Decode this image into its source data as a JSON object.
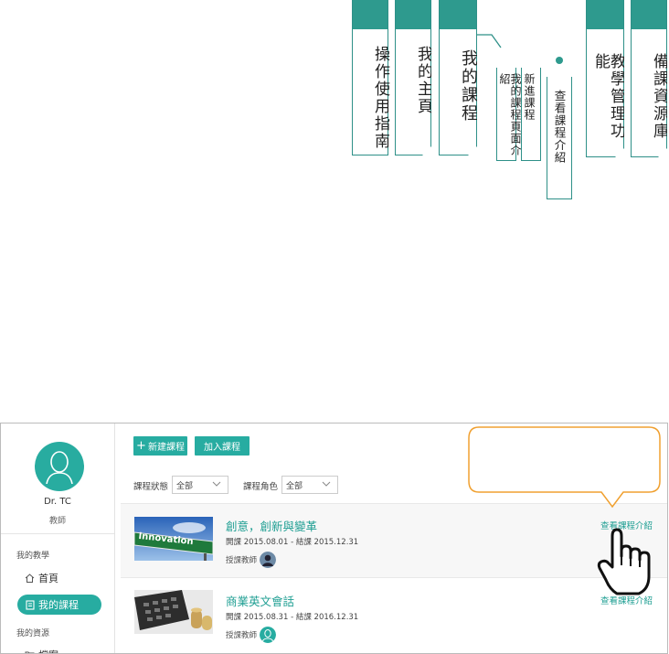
{
  "nav_tabs": [
    {
      "label": "操作使用指南"
    },
    {
      "label": "我的主頁"
    },
    {
      "label": "我的課程"
    },
    {
      "label": "教學管理功能"
    },
    {
      "label": "備課資源庫"
    }
  ],
  "sub_tabs": [
    {
      "label": "我的課程頁面介紹"
    },
    {
      "label": "新進課程"
    },
    {
      "label": "查看課程介紹"
    }
  ],
  "colors": {
    "accent": "#27aca1",
    "tab_border": "#2e9088",
    "callout_border": "#f0a030"
  },
  "sidebar": {
    "user_name": "Dr. TC",
    "user_role": "教師",
    "section_teaching": "我的教學",
    "home_label": "首頁",
    "my_courses_label": "我的課程",
    "section_resources": "我的資源",
    "cut_item_label": "檔案"
  },
  "toolbar": {
    "new_course": "新建課程",
    "join_course": "加入課程"
  },
  "filters": {
    "status_label": "課程狀態",
    "status_value": "全部",
    "role_label": "課程角色",
    "role_value": "全部"
  },
  "courses": [
    {
      "title": "創意，創新與變革",
      "dates": "開課  2015.08.01   -  結課  2015.12.31",
      "teacher_label": "授課教師",
      "thumb_text": "Innovation",
      "intro_link": "查看課程介紹"
    },
    {
      "title": "商業英文會話",
      "dates": "開課  2015.08.31   -  結課  2016.12.31",
      "teacher_label": "授課教師",
      "intro_link": "查看課程介紹"
    }
  ]
}
